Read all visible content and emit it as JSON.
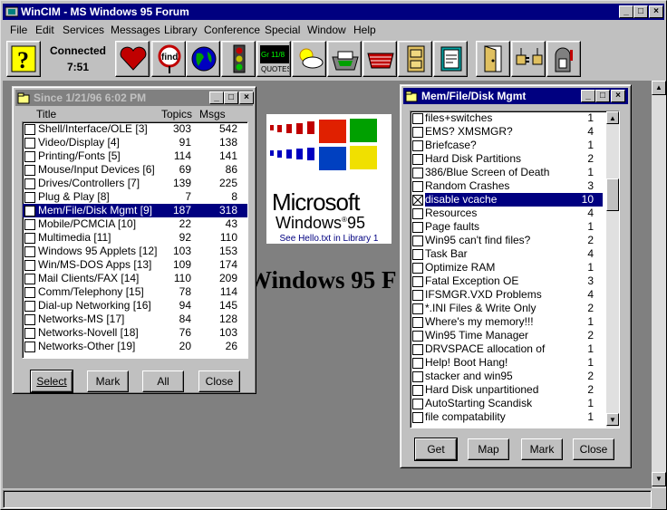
{
  "app": {
    "title": "WinCIM - MS Windows 95 Forum"
  },
  "menu": [
    "File",
    "Edit",
    "Services",
    "Messages",
    "Library",
    "Conference",
    "Special",
    "Window",
    "Help"
  ],
  "toolbar": {
    "status": "Connected",
    "time": "7:51",
    "quotes_label": "QUOTES",
    "quotes_ticker": "Gr 11/8"
  },
  "background_title": "Windows 95 F",
  "logo": {
    "brand": "Microsoft",
    "product": "Windows",
    "version": "95",
    "caption": "See Hello.txt in Library 1"
  },
  "left_window": {
    "title": "Since 1/21/96 6:02 PM",
    "columns": {
      "title": "Title",
      "topics": "Topics",
      "msgs": "Msgs"
    },
    "rows": [
      {
        "name": "Shell/Interface/OLE [3]",
        "topics": "303",
        "msgs": "542"
      },
      {
        "name": "Video/Display [4]",
        "topics": "91",
        "msgs": "138"
      },
      {
        "name": "Printing/Fonts [5]",
        "topics": "114",
        "msgs": "141"
      },
      {
        "name": "Mouse/Input Devices [6]",
        "topics": "69",
        "msgs": "86"
      },
      {
        "name": "Drives/Controllers [7]",
        "topics": "139",
        "msgs": "225"
      },
      {
        "name": "Plug & Play [8]",
        "topics": "7",
        "msgs": "8"
      },
      {
        "name": "Mem/File/Disk Mgmt [9]",
        "topics": "187",
        "msgs": "318"
      },
      {
        "name": "Mobile/PCMCIA [10]",
        "topics": "22",
        "msgs": "43"
      },
      {
        "name": "Multimedia [11]",
        "topics": "92",
        "msgs": "110"
      },
      {
        "name": "Windows 95 Applets [12]",
        "topics": "103",
        "msgs": "153"
      },
      {
        "name": "Win/MS-DOS Apps [13]",
        "topics": "109",
        "msgs": "174"
      },
      {
        "name": "Mail Clients/FAX [14]",
        "topics": "110",
        "msgs": "209"
      },
      {
        "name": "Comm/Telephony [15]",
        "topics": "78",
        "msgs": "114"
      },
      {
        "name": "Dial-up Networking [16]",
        "topics": "94",
        "msgs": "145"
      },
      {
        "name": "Networks-MS [17]",
        "topics": "84",
        "msgs": "128"
      },
      {
        "name": "Networks-Novell [18]",
        "topics": "76",
        "msgs": "103"
      },
      {
        "name": "Networks-Other [19]",
        "topics": "20",
        "msgs": "26"
      }
    ],
    "buttons": {
      "select": "Select",
      "mark": "Mark",
      "all": "All",
      "close": "Close"
    }
  },
  "right_window": {
    "title": "Mem/File/Disk Mgmt",
    "rows": [
      {
        "name": "files+switches",
        "count": "1"
      },
      {
        "name": "EMS? XMSMGR?",
        "count": "4"
      },
      {
        "name": "Briefcase?",
        "count": "1"
      },
      {
        "name": "Hard Disk Partitions",
        "count": "2"
      },
      {
        "name": "386/Blue Screen of Death",
        "count": "1"
      },
      {
        "name": "Random Crashes",
        "count": "3"
      },
      {
        "name": "disable vcache",
        "count": "10"
      },
      {
        "name": "Resources",
        "count": "4"
      },
      {
        "name": "Page faults",
        "count": "1"
      },
      {
        "name": "Win95 can't find files?",
        "count": "2"
      },
      {
        "name": "Task Bar",
        "count": "4"
      },
      {
        "name": "Optimize RAM",
        "count": "1"
      },
      {
        "name": "Fatal Exception OE",
        "count": "3"
      },
      {
        "name": "IFSMGR.VXD Problems",
        "count": "4"
      },
      {
        "name": "*.INI Files & Write Only",
        "count": "2"
      },
      {
        "name": "Where's my memory!!!",
        "count": "1"
      },
      {
        "name": "Win95 Time Manager",
        "count": "2"
      },
      {
        "name": "DRVSPACE  allocation of",
        "count": "1"
      },
      {
        "name": "Help!  Boot Hang!",
        "count": "1"
      },
      {
        "name": "stacker and win95",
        "count": "2"
      },
      {
        "name": "Hard Disk unpartitioned",
        "count": "2"
      },
      {
        "name": "AutoStarting Scandisk",
        "count": "1"
      },
      {
        "name": "file compatability",
        "count": "1"
      }
    ],
    "buttons": {
      "get": "Get",
      "map": "Map",
      "mark": "Mark",
      "close": "Close"
    }
  },
  "colors": {
    "titlebar_active": "#000080",
    "titlebar_inactive": "#808080",
    "selection": "#000080",
    "desktop": "#808080"
  }
}
